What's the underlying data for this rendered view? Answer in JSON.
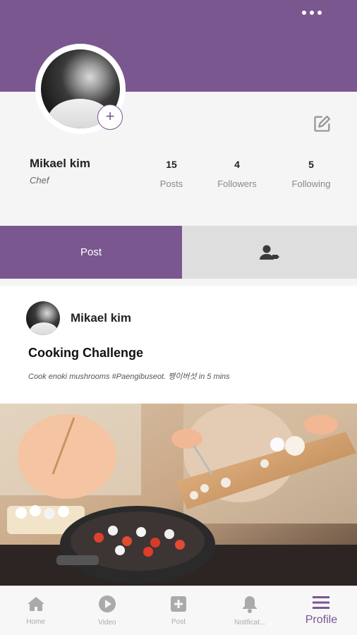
{
  "profile": {
    "name": "Mikael kim",
    "role": "Chef",
    "stats": [
      {
        "count": "15",
        "label": "Posts"
      },
      {
        "count": "4",
        "label": "Followers"
      },
      {
        "count": "5",
        "label": "Following"
      }
    ]
  },
  "tabs": {
    "post_label": "Post"
  },
  "post": {
    "author": "Mikael kim",
    "title": "Cooking Challenge",
    "description": "Cook enoki mushrooms #Paengibuseot. 팽이버섯 in 5 mins"
  },
  "nav": [
    {
      "label": "Home",
      "icon": "home-icon"
    },
    {
      "label": "Video",
      "icon": "play-circle-icon"
    },
    {
      "label": "Post",
      "icon": "add-box-icon"
    },
    {
      "label": "Notificat...",
      "icon": "bell-icon"
    },
    {
      "label": "Profile",
      "icon": "menu-icon"
    }
  ],
  "colors": {
    "accent": "#7b578f",
    "tab_inactive": "#dedede",
    "background": "#f5f5f5"
  }
}
